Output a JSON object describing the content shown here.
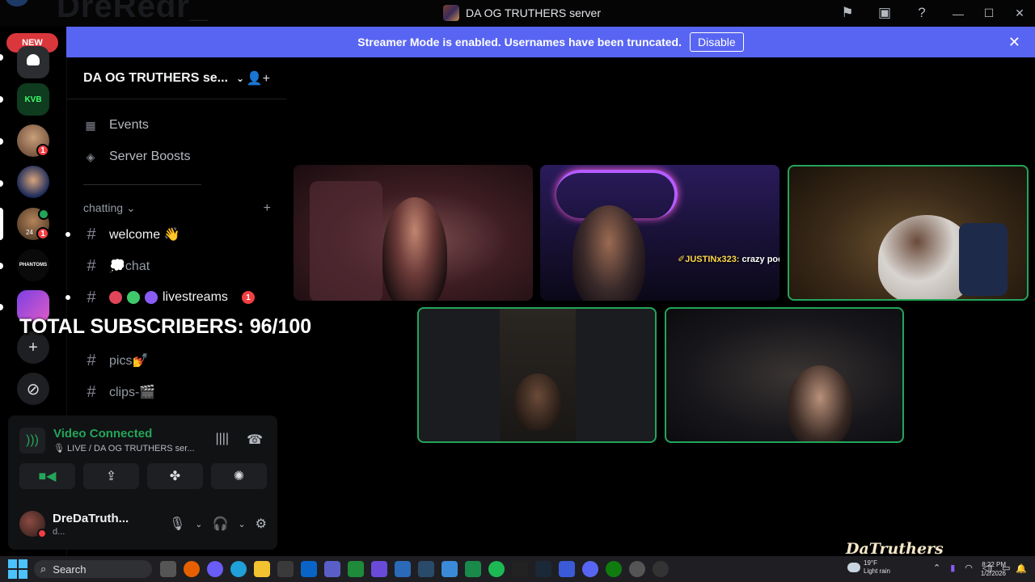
{
  "window": {
    "title": "DA OG TRUTHERS server",
    "ghost_text": "DreRedr_"
  },
  "banner": {
    "message": "Streamer Mode is enabled. Usernames have been truncated.",
    "disable_label": "Disable"
  },
  "rail": {
    "new_label": "NEW",
    "servers": [
      {
        "label": "KVB",
        "mentions": ""
      },
      {
        "label": "",
        "mentions": "1"
      },
      {
        "label": "",
        "mentions": ""
      },
      {
        "label": "24",
        "mentions": "1"
      },
      {
        "label": "PHANTOMS",
        "mentions": ""
      },
      {
        "label": "",
        "mentions": ""
      }
    ]
  },
  "server": {
    "name": "DA OG TRUTHERS se...",
    "nav": [
      {
        "label": "Events",
        "icon": "calendar-icon"
      },
      {
        "label": "Server Boosts",
        "icon": "boost-icon"
      }
    ],
    "category": "chatting",
    "channels": [
      {
        "name": "welcome 👋",
        "unread": true
      },
      {
        "name": "💭chat",
        "unread": false
      },
      {
        "name": "livestreams",
        "unread": true,
        "badge": "1"
      },
      {
        "name": "pics💅",
        "unread": false
      },
      {
        "name": "clips-🎬",
        "unread": false
      }
    ]
  },
  "overlay": {
    "text": "TOTAL SUBSCRIBERS: 96/100"
  },
  "voice": {
    "title": "Video Connected",
    "subtitle": "🎙 LIVE / DA OG TRUTHERS ser..."
  },
  "user": {
    "name": "DreDaTruth...",
    "status": "d..."
  },
  "stage": {
    "chat_user": "✐JUSTINx323:",
    "chat_message": " crazy podcast",
    "watermark": "DaTruthers"
  },
  "taskbar": {
    "search_label": "Search",
    "weather_temp": "19°F",
    "weather_desc": "Light rain",
    "time": "8:22 PM",
    "date": "1/2/2026"
  },
  "colors": {
    "brand": "#5865f2",
    "connected": "#23a55a",
    "mention": "#f23f43"
  }
}
